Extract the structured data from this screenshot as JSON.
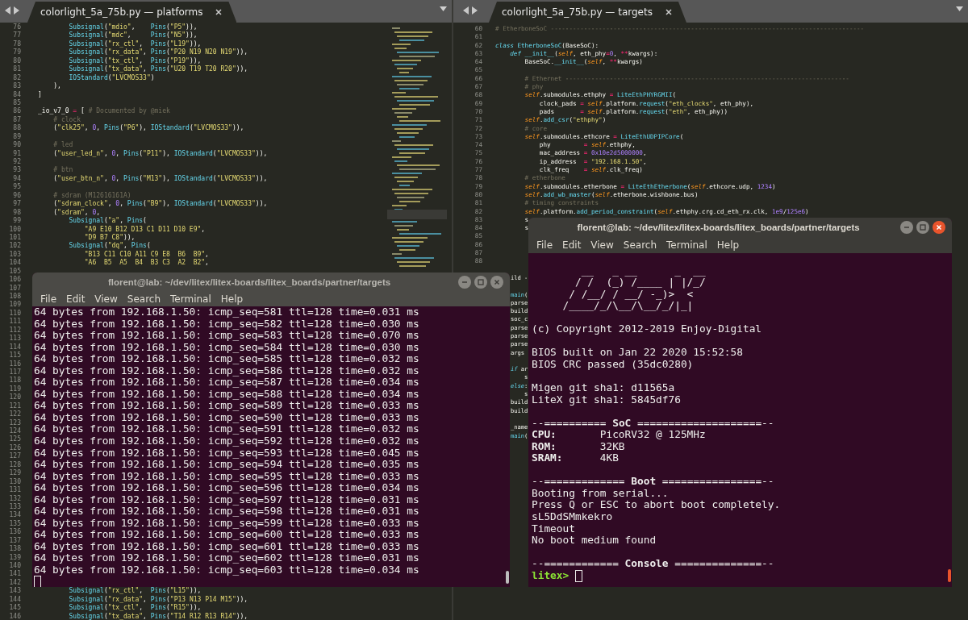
{
  "editors": [
    {
      "tab": {
        "title": "colorlight_5a_75b.py — platforms",
        "selected": true
      },
      "lines": [
        {
          "num": "76",
          "text": "        Subsignal(\"mdio\",    Pins(\"P5\")),"
        },
        {
          "num": "77",
          "text": "        Subsignal(\"mdc\",     Pins(\"N5\")),"
        },
        {
          "num": "78",
          "text": "        Subsignal(\"rx_ctl\",  Pins(\"L19\")),"
        },
        {
          "num": "79",
          "text": "        Subsignal(\"rx_data\", Pins(\"P20 N19 N20 N19\")),"
        },
        {
          "num": "80",
          "text": "        Subsignal(\"tx_ctl\",  Pins(\"P19\")),"
        },
        {
          "num": "81",
          "text": "        Subsignal(\"tx_data\", Pins(\"U20 T19 T20 R20\")),"
        },
        {
          "num": "82",
          "text": "        IOStandard(\"LVCMOS33\")"
        },
        {
          "num": "83",
          "text": "    ),"
        },
        {
          "num": "84",
          "text": "]"
        },
        {
          "num": "85"
        },
        {
          "num": "86",
          "text": "_io_v7_0 = [ # Documented by @miek"
        },
        {
          "num": "87",
          "text": "    # clock"
        },
        {
          "num": "88",
          "text": "    (\"clk25\", 0, Pins(\"P6\"), IOStandard(\"LVCMOS33\")),"
        },
        {
          "num": "89"
        },
        {
          "num": "90",
          "text": "    # led"
        },
        {
          "num": "91",
          "text": "    (\"user_led_n\", 0, Pins(\"P11\"), IOStandard(\"LVCMOS33\")),"
        },
        {
          "num": "92"
        },
        {
          "num": "93",
          "text": "    # btn"
        },
        {
          "num": "94",
          "text": "    (\"user_btn_n\", 0, Pins(\"M13\"), IOStandard(\"LVCMOS33\")),"
        },
        {
          "num": "95"
        },
        {
          "num": "96",
          "text": "    # sdram (M12616161A)"
        },
        {
          "num": "97",
          "text": "    (\"sdram_clock\", 0, Pins(\"B9\"), IOStandard(\"LVCMOS33\")),"
        },
        {
          "num": "98",
          "text": "    (\"sdram\", 0,"
        },
        {
          "num": "99",
          "text": "        Subsignal(\"a\", Pins("
        },
        {
          "num": "100",
          "text": "            \"A9 E10 B12 D13 C1 D11 D10 E9\","
        },
        {
          "num": "101",
          "text": "            \"D9 B7 C8\")),"
        },
        {
          "num": "102",
          "text": "        Subsignal(\"dq\", Pins("
        },
        {
          "num": "103",
          "text": "            \"B13 C11 C10 A11 C9 E8  B6  B9\","
        },
        {
          "num": "104",
          "text": "            \"A6  B5  A5  B4  B3 C3  A2  B2\","
        },
        {
          "num": "105"
        },
        {
          "num": "106"
        },
        {
          "num": "107"
        },
        {
          "num": "108"
        },
        {
          "num": "109"
        },
        {
          "num": "110"
        },
        {
          "num": "111"
        },
        {
          "num": "112"
        },
        {
          "num": "113"
        },
        {
          "num": "114"
        },
        {
          "num": "115"
        },
        {
          "num": "116"
        },
        {
          "num": "117"
        },
        {
          "num": "118"
        },
        {
          "num": "119"
        },
        {
          "num": "120"
        },
        {
          "num": "121"
        },
        {
          "num": "122"
        },
        {
          "num": "123"
        },
        {
          "num": "124"
        },
        {
          "num": "125"
        },
        {
          "num": "126"
        },
        {
          "num": "127"
        },
        {
          "num": "128"
        },
        {
          "num": "129"
        },
        {
          "num": "130"
        },
        {
          "num": "131"
        },
        {
          "num": "132"
        },
        {
          "num": "133"
        },
        {
          "num": "134"
        },
        {
          "num": "135"
        },
        {
          "num": "136"
        },
        {
          "num": "137"
        },
        {
          "num": "138"
        },
        {
          "num": "139"
        },
        {
          "num": "140"
        },
        {
          "num": "141"
        },
        {
          "num": "142"
        },
        {
          "num": "143",
          "text": "        Subsignal(\"rx_ctl\",  Pins(\"L15\")),"
        },
        {
          "num": "144",
          "text": "        Subsignal(\"rx_data\", Pins(\"P13 N13 P14 M15\")),"
        },
        {
          "num": "145",
          "text": "        Subsignal(\"tx_ctl\",  Pins(\"R15\")),"
        },
        {
          "num": "146",
          "text": "        Subsignal(\"tx_data\", Pins(\"T14 R12 R13 R14\")),"
        }
      ]
    },
    {
      "tab": {
        "title": "colorlight_5a_75b.py — targets",
        "selected": true
      },
      "lines": [
        {
          "num": "60",
          "text": "# EtherboneSoC -------------------------------------------------------------------------------------"
        },
        {
          "num": "61"
        },
        {
          "num": "62",
          "text": "class EtherboneSoC(BaseSoC):"
        },
        {
          "num": "63",
          "text": "    def __init__(self, eth_phy=0, **kwargs):"
        },
        {
          "num": "64",
          "text": "        BaseSoC.__init__(self, **kwargs)"
        },
        {
          "num": "65"
        },
        {
          "num": "66",
          "text": "        # Ethernet -----------------------------------------------------------------------------"
        },
        {
          "num": "67",
          "text": "        # phy"
        },
        {
          "num": "68",
          "text": "        self.submodules.ethphy = LiteEthPHYRGMII("
        },
        {
          "num": "69",
          "text": "            clock_pads = self.platform.request(\"eth_clocks\", eth_phy),"
        },
        {
          "num": "70",
          "text": "            pads       = self.platform.request(\"eth\", eth_phy))"
        },
        {
          "num": "71",
          "text": "        self.add_csr(\"ethphy\")"
        },
        {
          "num": "72",
          "text": "        # core"
        },
        {
          "num": "73",
          "text": "        self.submodules.ethcore = LiteEthUDPIPCore("
        },
        {
          "num": "74",
          "text": "            phy         = self.ethphy,"
        },
        {
          "num": "75",
          "text": "            mac_address = 0x10e2d5000000,"
        },
        {
          "num": "76",
          "text": "            ip_address  = \"192.168.1.50\","
        },
        {
          "num": "77",
          "text": "            clk_freq    = self.clk_freq)"
        },
        {
          "num": "78",
          "text": "        # etherbone"
        },
        {
          "num": "79",
          "text": "        self.submodules.etherbone = LiteEthEtherbone(self.ethcore.udp, 1234)"
        },
        {
          "num": "80",
          "text": "        self.add_wb_master(self.etherbone.wishbone.bus)"
        },
        {
          "num": "81",
          "text": "        # timing constraints"
        },
        {
          "num": "82",
          "text": "        self.platform.add_period_constraint(self.ethphy.crg.cd_eth_rx.clk, 1e9/125e6)"
        },
        {
          "num": "83",
          "text": "        s"
        },
        {
          "num": "84",
          "text": "        s"
        },
        {
          "num": "85"
        },
        {
          "num": "86"
        },
        {
          "num": "87"
        },
        {
          "num": "88"
        }
      ],
      "covered_fragments": [
        [
          "ild -"
        ],
        [
          "main(",
          "parse",
          "build",
          "soc_c",
          "parse",
          "parse",
          "parse",
          "args"
        ],
        [
          "if ar",
          "    s",
          "else:",
          "    s",
          "build",
          "build"
        ],
        [
          "_name",
          "main("
        ]
      ]
    }
  ],
  "terminals": [
    {
      "title": "florent@lab: ~/dev/litex/litex-boards/litex_boards/partner/targets",
      "focused": false,
      "menu": [
        "File",
        "Edit",
        "View",
        "Search",
        "Terminal",
        "Help"
      ],
      "blocks": [
        [
          "64 bytes from 192.168.1.50: icmp_seq=581 ttl=128 time=0.031 ms",
          "64 bytes from 192.168.1.50: icmp_seq=582 ttl=128 time=0.030 ms",
          "64 bytes from 192.168.1.50: icmp_seq=583 ttl=128 time=0.070 ms",
          "64 bytes from 192.168.1.50: icmp_seq=584 ttl=128 time=0.030 ms",
          "64 bytes from 192.168.1.50: icmp_seq=585 ttl=128 time=0.032 ms",
          "64 bytes from 192.168.1.50: icmp_seq=586 ttl=128 time=0.032 ms",
          "64 bytes from 192.168.1.50: icmp_seq=587 ttl=128 time=0.034 ms",
          "64 bytes from 192.168.1.50: icmp_seq=588 ttl=128 time=0.034 ms",
          "64 bytes from 192.168.1.50: icmp_seq=589 ttl=128 time=0.033 ms",
          "64 bytes from 192.168.1.50: icmp_seq=590 ttl=128 time=0.033 ms",
          "64 bytes from 192.168.1.50: icmp_seq=591 ttl=128 time=0.032 ms",
          "64 bytes from 192.168.1.50: icmp_seq=592 ttl=128 time=0.032 ms",
          "64 bytes from 192.168.1.50: icmp_seq=593 ttl=128 time=0.045 ms",
          "64 bytes from 192.168.1.50: icmp_seq=594 ttl=128 time=0.035 ms",
          "64 bytes from 192.168.1.50: icmp_seq=595 ttl=128 time=0.033 ms",
          "64 bytes from 192.168.1.50: icmp_seq=596 ttl=128 time=0.034 ms",
          "64 bytes from 192.168.1.50: icmp_seq=597 ttl=128 time=0.031 ms",
          "64 bytes from 192.168.1.50: icmp_seq=598 ttl=128 time=0.031 ms",
          "64 bytes from 192.168.1.50: icmp_seq=599 ttl=128 time=0.033 ms",
          "64 bytes from 192.168.1.50: icmp_seq=600 ttl=128 time=0.033 ms",
          "64 bytes from 192.168.1.50: icmp_seq=601 ttl=128 time=0.033 ms",
          "64 bytes from 192.168.1.50: icmp_seq=602 ttl=128 time=0.031 ms",
          "64 bytes from 192.168.1.50: icmp_seq=603 ttl=128 time=0.034 ms"
        ]
      ]
    },
    {
      "title": "florent@lab: ~/dev/litex/litex-boards/litex_boards/partner/targets",
      "focused": true,
      "menu": [
        "File",
        "Edit",
        "View",
        "Search",
        "Terminal",
        "Help"
      ],
      "blocks": [
        [
          "        __   _ __      _  __",
          "       / /  (_) /____ | |/_/",
          "      / /__/ / __/ -_)>  <",
          "     /____/_/\\__/\\__/_/|_|"
        ],
        [
          "(c) Copyright 2012-2019 Enjoy-Digital"
        ],
        [
          "BIOS built on Jan 22 2020 15:52:58",
          "BIOS CRC passed (35dc0280)"
        ],
        [
          "Migen git sha1: d11565a",
          "LiteX git sha1: 5845df76"
        ],
        [
          "--========== **SoC** ====================--",
          "**CPU:**       PicoRV32 @ 125MHz",
          "**ROM:**       32KB",
          "**SRAM:**      4KB"
        ],
        [
          "--============= **Boot** ================--",
          "Booting from serial...",
          "Press Q or ESC to abort boot completely.",
          "sL5DdSMmkekro",
          "Timeout",
          "No boot medium found"
        ],
        [
          "--============ **Console** ==============--"
        ]
      ],
      "prompt": "litex>"
    }
  ]
}
